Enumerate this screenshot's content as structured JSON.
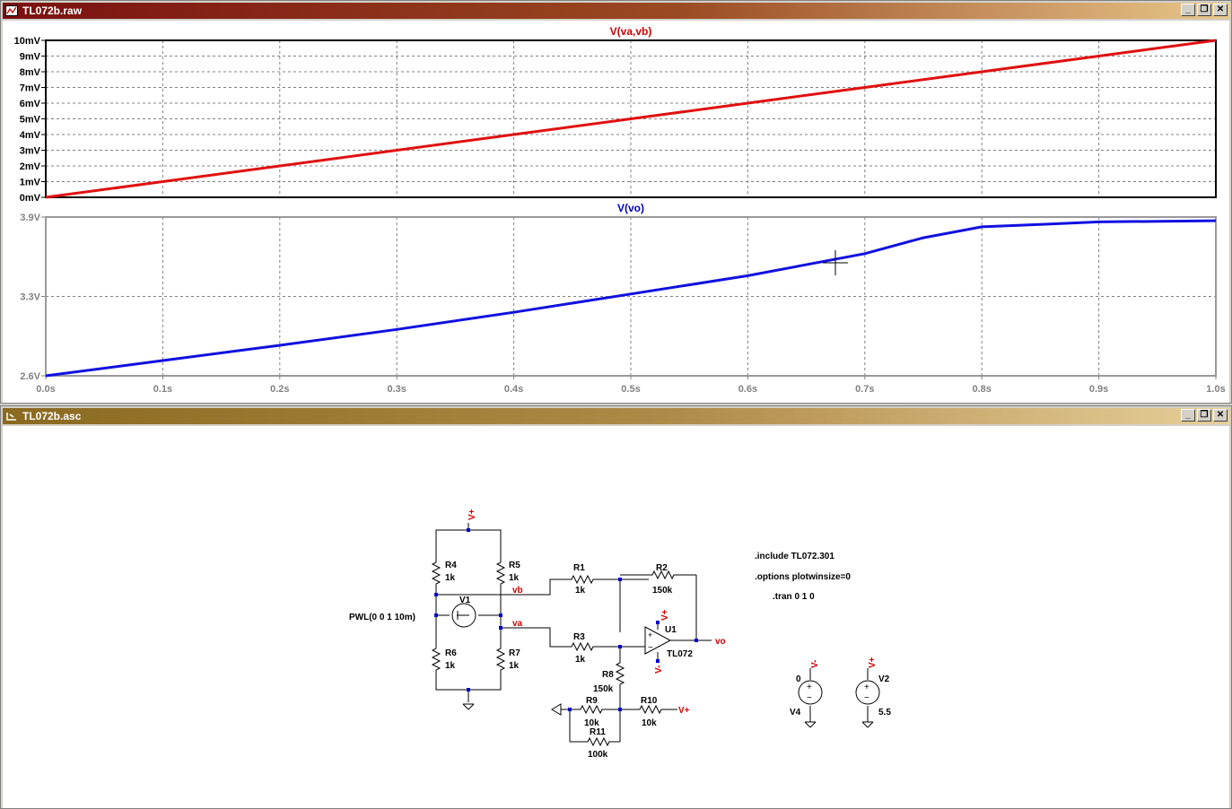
{
  "waveform_window": {
    "title": "TL072b.raw",
    "buttons": {
      "minimize": "_",
      "restore": "❐",
      "close": "✕"
    }
  },
  "schematic_window": {
    "title": "TL072b.asc",
    "buttons": {
      "minimize": "_",
      "restore": "❐",
      "close": "✕"
    }
  },
  "chart_data": [
    {
      "type": "line",
      "title": "V(va,vb)",
      "x": [
        0.0,
        0.1,
        0.2,
        0.3,
        0.4,
        0.5,
        0.6,
        0.7,
        0.8,
        0.9,
        1.0
      ],
      "series": [
        {
          "name": "V(va,vb)",
          "color": "#e01010",
          "unit": "mV",
          "values": [
            0,
            1,
            2,
            3,
            4,
            5,
            6,
            7,
            8,
            9,
            10
          ]
        }
      ],
      "ylim": [
        0,
        10
      ],
      "y_ticks": [
        "0mV",
        "1mV",
        "2mV",
        "3mV",
        "4mV",
        "5mV",
        "6mV",
        "7mV",
        "8mV",
        "9mV",
        "10mV"
      ],
      "grid": true
    },
    {
      "type": "line",
      "title": "V(vo)",
      "x": [
        0.0,
        0.1,
        0.2,
        0.3,
        0.4,
        0.5,
        0.6,
        0.7,
        0.75,
        0.8,
        0.85,
        0.9,
        1.0
      ],
      "series": [
        {
          "name": "V(vo)",
          "color": "#1010e0",
          "unit": "V",
          "values": [
            2.6,
            2.725,
            2.85,
            2.98,
            3.12,
            3.27,
            3.42,
            3.6,
            3.73,
            3.82,
            3.84,
            3.86,
            3.87
          ]
        }
      ],
      "ylim": [
        2.6,
        3.9
      ],
      "y_ticks": [
        "2.6V",
        "3.3V",
        "3.9V"
      ],
      "x_ticks": [
        "0.0s",
        "0.1s",
        "0.2s",
        "0.3s",
        "0.4s",
        "0.5s",
        "0.6s",
        "0.7s",
        "0.8s",
        "0.9s",
        "1.0s"
      ],
      "grid": true
    }
  ],
  "schematic": {
    "components": {
      "R4": {
        "name": "R4",
        "value": "1k"
      },
      "R5": {
        "name": "R5",
        "value": "1k"
      },
      "R6": {
        "name": "R6",
        "value": "1k"
      },
      "R7": {
        "name": "R7",
        "value": "1k"
      },
      "R1": {
        "name": "R1",
        "value": "1k"
      },
      "R2": {
        "name": "R2",
        "value": "150k"
      },
      "R3": {
        "name": "R3",
        "value": "1k"
      },
      "R8": {
        "name": "R8",
        "value": "150k"
      },
      "R9": {
        "name": "R9",
        "value": "10k"
      },
      "R10": {
        "name": "R10",
        "value": "10k"
      },
      "R11": {
        "name": "R11",
        "value": "100k"
      },
      "V1": {
        "name": "V1",
        "value": "PWL(0 0 1 10m)"
      },
      "U1": {
        "name": "U1",
        "value": "TL072"
      },
      "V2": {
        "name": "V2",
        "value": "5.5"
      },
      "V4": {
        "name": "V4",
        "value": "0"
      }
    },
    "nets": {
      "vplus": "V+",
      "vminus": "V-",
      "vb": "vb",
      "va": "va",
      "vo": "vo",
      "vplus_short": "V+"
    },
    "directives": {
      "include": ".include TL072.301",
      "options": ".options plotwinsize=0",
      "tran": ".tran 0 1 0"
    }
  }
}
